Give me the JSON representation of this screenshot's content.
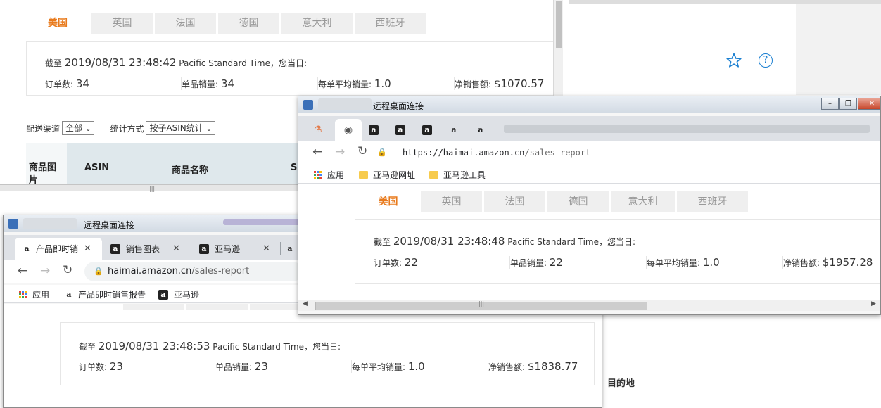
{
  "background": {
    "country_tabs": [
      "美国",
      "英国",
      "法国",
      "德国",
      "意大利",
      "西班牙"
    ],
    "active_tab": "美国",
    "summary": {
      "prefix": "截至",
      "datetime": "2019/08/31 23:48:42",
      "timezone": "Pacific Standard Time",
      "suffix": "，您当日:"
    },
    "stats": [
      {
        "label": "订单数:",
        "value": "34"
      },
      {
        "label": "单品销量:",
        "value": "34"
      },
      {
        "label": "每单平均销量:",
        "value": "1.0"
      },
      {
        "label": "净销售额:",
        "value": "$1070.57"
      }
    ],
    "filters": {
      "channel_label": "配送渠道",
      "channel_value": "全部",
      "stat_label": "统计方式",
      "stat_value": "按子ASIN统计"
    },
    "table_headers": [
      "商品图片",
      "ASIN",
      "商品名称",
      "S"
    ],
    "right_label": "目的地"
  },
  "window_front": {
    "title": "远程桌面连接",
    "url_host": "https://haimai.amazon.cn",
    "url_path": "/sales-report",
    "bookmarks": [
      "应用",
      "亚马逊网址",
      "亚马逊工具"
    ],
    "country_tabs": [
      "美国",
      "英国",
      "法国",
      "德国",
      "意大利",
      "西班牙"
    ],
    "summary": {
      "prefix": "截至",
      "datetime": "2019/08/31 23:48:48",
      "timezone": "Pacific Standard Time",
      "suffix": "，您当日:"
    },
    "stats": [
      {
        "label": "订单数:",
        "value": "22"
      },
      {
        "label": "单品销量:",
        "value": "22"
      },
      {
        "label": "每单平均销量:",
        "value": "1.0"
      },
      {
        "label": "净销售额:",
        "value": "$1957.28"
      }
    ]
  },
  "window_back": {
    "title": "远程桌面连接",
    "tabs": [
      "产品即时销",
      "销售图表",
      "亚马逊"
    ],
    "url_host": "haimai.amazon.cn",
    "url_path": "/sales-report",
    "bookmarks": [
      "应用",
      "产品即时销售报告",
      "亚马逊"
    ],
    "summary": {
      "prefix": "截至",
      "datetime": "2019/08/31 23:48:53",
      "timezone": "Pacific Standard Time",
      "suffix": "，您当日:"
    },
    "stats": [
      {
        "label": "订单数:",
        "value": "23"
      },
      {
        "label": "单品销量:",
        "value": "23"
      },
      {
        "label": "每单平均销量:",
        "value": "1.0"
      },
      {
        "label": "净销售额:",
        "value": "$1838.77"
      }
    ]
  },
  "colors": {
    "accent": "#e87a1c",
    "table_header": "#dfe8ec",
    "star_icon": "#1a7fd1"
  }
}
